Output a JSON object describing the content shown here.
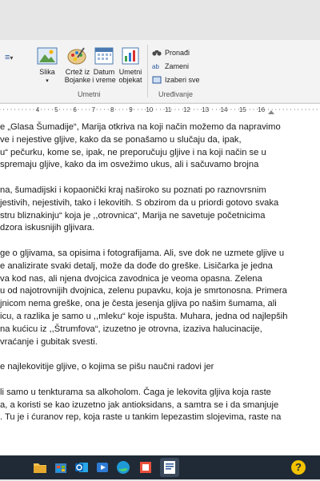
{
  "ribbon": {
    "list_icon": "≡",
    "list_arrow": "▾",
    "buttons": {
      "slika": "Slika",
      "slika_arrow": "▾",
      "crtez_line1": "Crtež iz",
      "crtez_line2": "Bojanke",
      "datum_line1": "Datum",
      "datum_line2": "i vreme",
      "umetni_line1": "Umetni",
      "umetni_line2": "objekat"
    },
    "group_umetni": "Umetni",
    "editing": {
      "pronadi": "Pronađi",
      "zameni": "Zameni",
      "izaberi": "Izaberi sve"
    },
    "group_uredjivanje": "Uređivanje"
  },
  "ruler": {
    "labels": [
      "4",
      "5",
      "6",
      "7",
      "8",
      "9",
      "10",
      "11",
      "12",
      "13",
      "14",
      "15",
      "16"
    ]
  },
  "document": {
    "lines": [
      "e „Glasa Šumadije“, Marija otkriva na koji način možemo da napravimo",
      "ve i nejestive gljive, kako da se ponašamo u slučaju da, ipak,",
      "u“ pečurku, kome se, ipak, ne preporučuju gljive i na koji način se u",
      "spremaju gljive, kako da im osvežimo ukus, ali i sačuvamo brojna",
      "",
      "na, šumadijski i kopaonički kraj naširoko su poznati po raznovrsnim",
      " jestivih, nejestivih, tako i lekovitih. S obzirom da u priordi gotovo  svaka",
      "stru bliznakinju“ koja je ,,otrovnica“, Marija ne savetuje  početnicima",
      "dzora iskusnijih gljivara.",
      "",
      "ge o gljivama, sa opisima i fotografijama. Ali, sve dok ne uzmete gljive u",
      "e analizirate svaki detalj, može da dođe do greške.  Lisičarka je jedna",
      "va kod nas, ali njena dvojcica zavodnica je veoma opasna. Zelena",
      "u od najotrovnijih dvojnica, zelenu pupavku, koja je smrtonosna.  Primera",
      "jnicom nema greške, ona je česta jesenja gljiva po našim šumama, ali",
      "icu, a razlika je samo u ,,mleku“ koje ispušta.  Muhara, jedna od najlepših",
      "na kućicu iz ,,Štrumfova“, izuzetno je otrovna, izaziva halucinacije,",
      "vraćanje i gubitak svesti.",
      "",
      "e najlekovitije gljive, o kojima se pišu naučni radovi jer",
      "",
      "li samo u tenkturama sa alkoholom.  Čaga je lekovita gljiva koja raste",
      "a, a koristi se kao izuzetno jak antioksidans, a samtra se i da smanjuje",
      ". Tu je i ćuranov rep, koja raste u tankim lepezastim slojevima, raste na"
    ]
  },
  "taskbar": {
    "help_label": "?"
  },
  "colors": {
    "ribbon_bg": "#f3f3f3",
    "taskbar_bg": "#1f2a36",
    "accent_blue": "#2b579a"
  }
}
